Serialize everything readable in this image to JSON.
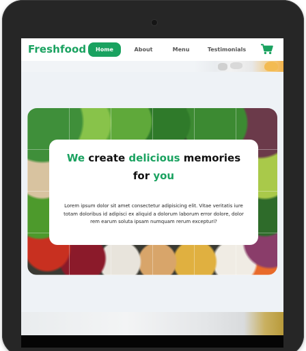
{
  "brand": {
    "name": "Freshfood",
    "accent": "#1aa260"
  },
  "nav": {
    "items": [
      {
        "label": "Home",
        "active": true
      },
      {
        "label": "About",
        "active": false
      },
      {
        "label": "Menu",
        "active": false
      },
      {
        "label": "Testimonials",
        "active": false
      }
    ],
    "cart_icon": "shopping-cart-icon"
  },
  "hero": {
    "title_part1": "We",
    "title_part2": "create",
    "title_part3": "delicious",
    "title_part4": "memories",
    "title_part5": "for",
    "title_part6": "you",
    "body": "Lorem ipsum dolor sit amet consectetur adipisicing elit. Vitae veritatis iure totam doloribus id adipisci ex aliquid a dolorum laborum error dolore, dolor rem earum soluta ipsam numquam rerum excepturi?"
  }
}
